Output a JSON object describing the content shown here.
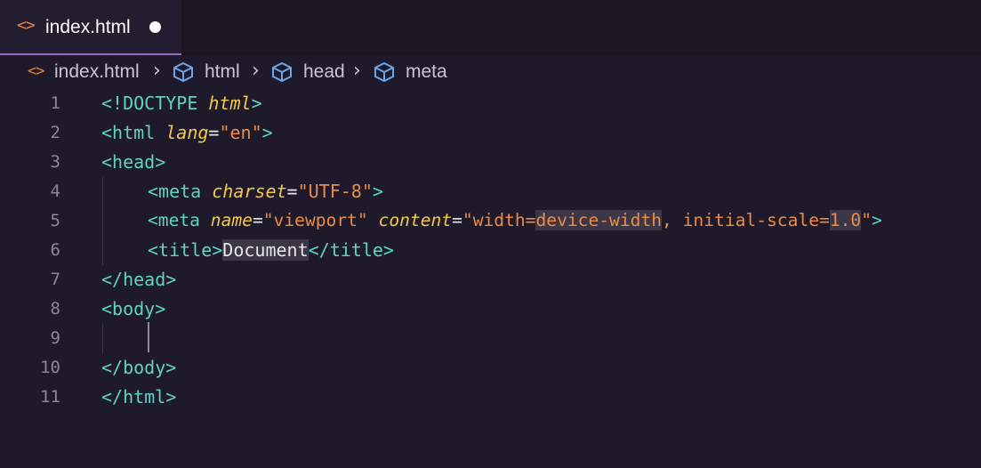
{
  "tab": {
    "icon": "html-file-icon",
    "title": "index.html",
    "dirty_indicator": "unsaved-dot"
  },
  "breadcrumb": {
    "file": "index.html",
    "items": [
      "html",
      "head",
      "meta"
    ]
  },
  "colors": {
    "tag": "#5fd3c5",
    "attribute": "#f3c74a",
    "string": "#ec8b45",
    "text": "#e8e6ef",
    "line_number": "#8b8799",
    "accent": "#9a6ac2"
  },
  "editor": {
    "lines": [
      {
        "n": "1",
        "text": "<!DOCTYPE html>"
      },
      {
        "n": "2",
        "text": "<html lang=\"en\">"
      },
      {
        "n": "3",
        "text": "<head>"
      },
      {
        "n": "4",
        "text": "<meta charset=\"UTF-8\">"
      },
      {
        "n": "5",
        "text": "<meta name=\"viewport\" content=\"width=device-width, initial-scale=1.0\">"
      },
      {
        "n": "6",
        "text": "<title>Document</title>"
      },
      {
        "n": "7",
        "text": "</head>"
      },
      {
        "n": "8",
        "text": "<body>"
      },
      {
        "n": "9",
        "text": ""
      },
      {
        "n": "10",
        "text": "</body>"
      },
      {
        "n": "11",
        "text": "</html>"
      }
    ],
    "tokens": {
      "doctype_open": "<!DOCTYPE ",
      "doctype_html": "html",
      "doctype_close": ">",
      "html_open": "<html ",
      "lang_attr": "lang",
      "eq": "=",
      "lang_val": "\"en\"",
      "gt": ">",
      "head_open": "<head>",
      "meta_open": "<meta ",
      "charset_attr": "charset",
      "charset_val": "\"UTF-8\"",
      "name_attr": "name",
      "name_val": "\"viewport\"",
      "space": " ",
      "content_attr": "content",
      "content_val_a": "\"width=",
      "content_val_hl1": "device-width",
      "content_val_b": ", initial-scale=",
      "content_val_hl2": "1.0",
      "content_val_c": "\"",
      "title_open": "<title>",
      "title_text": "Document",
      "title_close": "</title>",
      "head_close": "</head>",
      "body_open": "<body>",
      "body_close": "</body>",
      "html_close": "</html>"
    }
  }
}
